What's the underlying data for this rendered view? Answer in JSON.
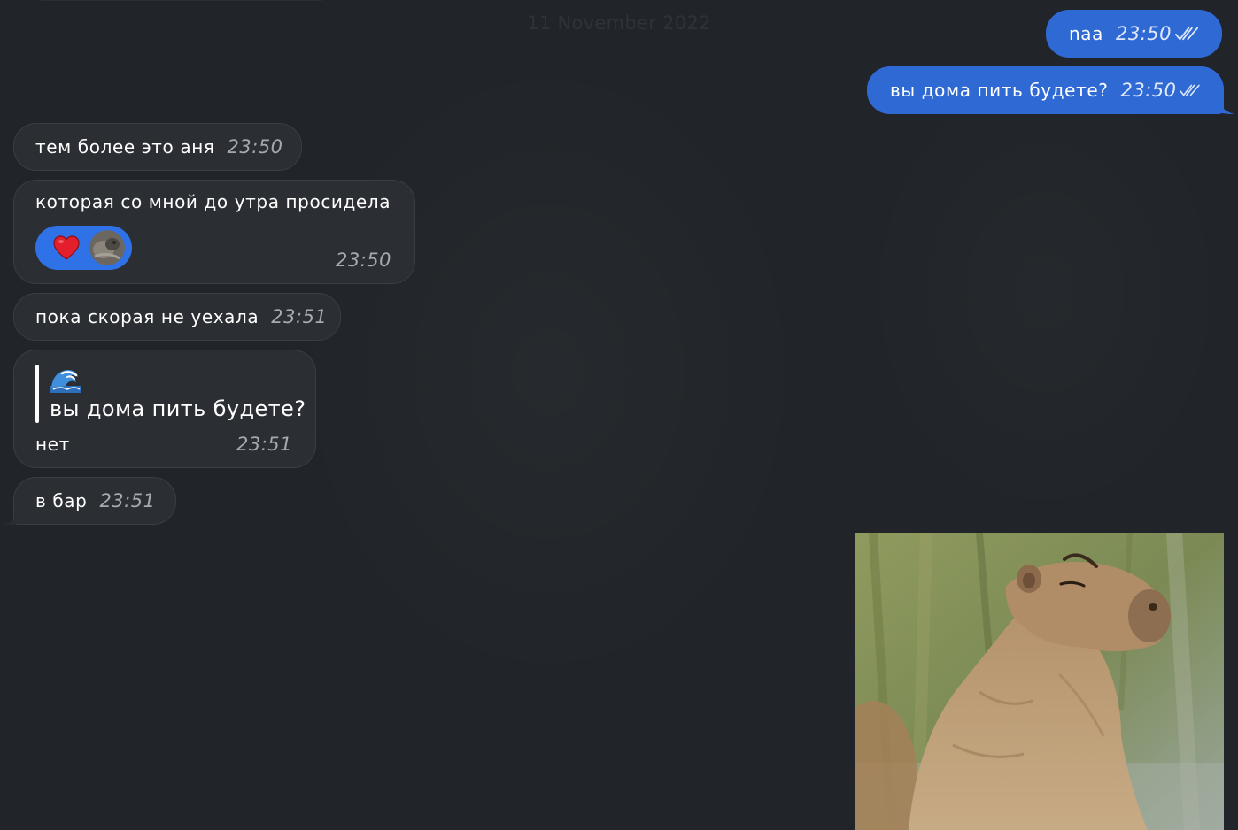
{
  "date_separator": "11 November 2022",
  "colors": {
    "background": "#212529",
    "incoming_bubble": "#2b2e33",
    "outgoing_bubble": "#2f6ad4",
    "reaction_pill": "#2f72e8"
  },
  "messages": [
    {
      "direction": "out",
      "text": "naa",
      "time": "23:50",
      "status": "read-double-check"
    },
    {
      "direction": "out",
      "text": "вы дома пить будете?",
      "time": "23:50",
      "status": "read-double-check"
    },
    {
      "direction": "in",
      "text": "тем более это аня",
      "time": "23:50"
    },
    {
      "direction": "in",
      "text": "которая со мной до утра просидела",
      "time": "23:50",
      "reactions": [
        {
          "emoji": "heart-icon",
          "by": "avatar"
        }
      ]
    },
    {
      "direction": "in",
      "text": "пока скорая не уехала",
      "time": "23:51"
    },
    {
      "direction": "in",
      "text": "нет",
      "time": "23:51",
      "reply_to": {
        "sender_icon": "wave-emoji-icon",
        "text": "вы дома пить будете?"
      }
    },
    {
      "direction": "in",
      "text": "в бар",
      "time": "23:51"
    },
    {
      "direction": "out",
      "type": "photo",
      "description": "capybara-photo"
    }
  ]
}
